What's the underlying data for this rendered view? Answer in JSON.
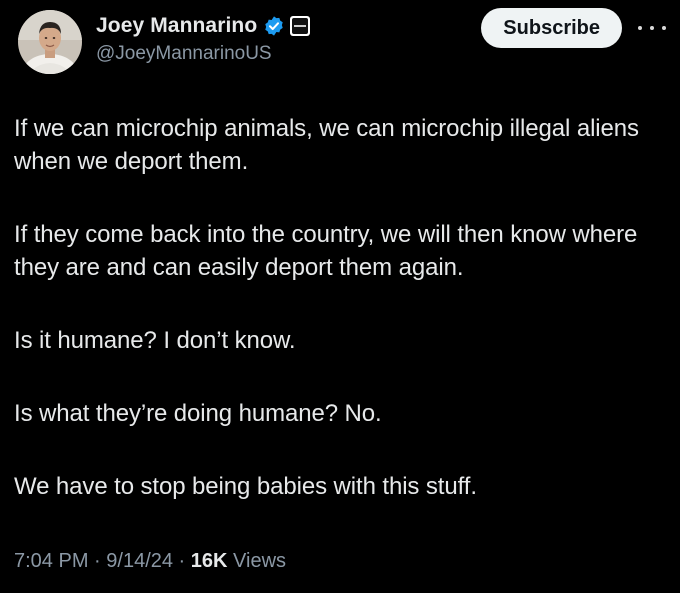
{
  "author": {
    "display_name": "Joey Mannarino",
    "handle": "@JoeyMannarinoUS",
    "verified": true,
    "verified_color": "#1d9bf0",
    "avatar_icon": "profile-photo"
  },
  "actions": {
    "subscribe_label": "Subscribe",
    "more_icon": "more-horizontal-icon"
  },
  "tweet": {
    "paragraphs": [
      "If we can microchip animals, we can microchip illegal aliens when we deport them.",
      "If they come back into the country, we will then know where they are and can easily deport them again.",
      "Is it humane? I don’t know.",
      "Is what they’re doing humane? No.",
      "We have to stop being babies with this stuff."
    ]
  },
  "meta": {
    "time": "7:04 PM",
    "separator": " · ",
    "date": "9/14/24",
    "views_count": "16K",
    "views_label": " Views"
  }
}
